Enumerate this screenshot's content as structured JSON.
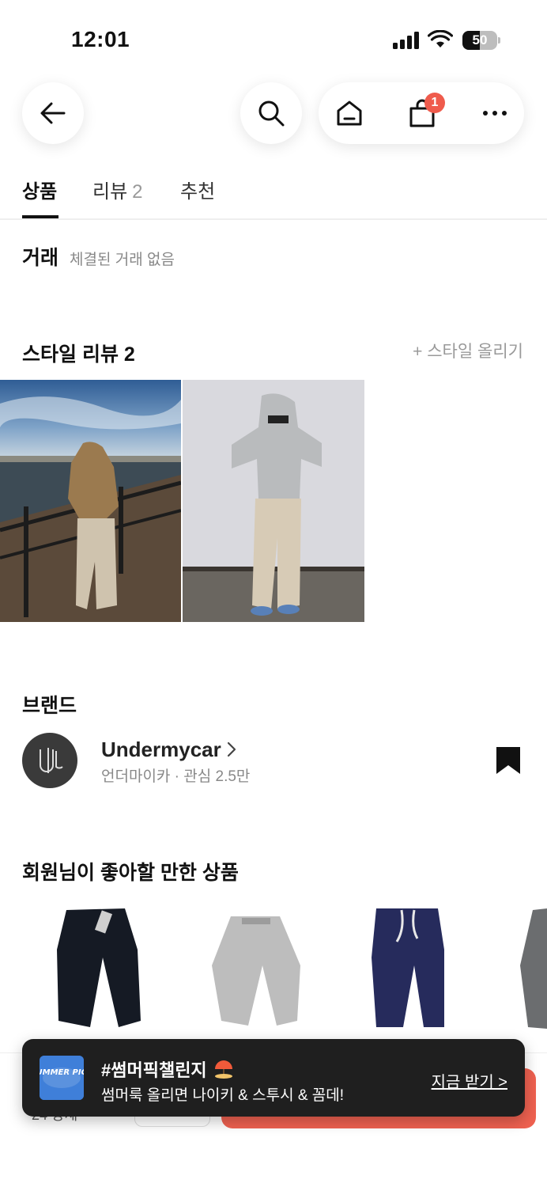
{
  "status_bar": {
    "time": "12:01",
    "battery_level": "50",
    "battery_fraction": 0.5
  },
  "header": {
    "cart_badge": "1"
  },
  "tabs": [
    {
      "label": "상품",
      "active": true
    },
    {
      "label": "리뷰",
      "count": "2"
    },
    {
      "label": "추천"
    }
  ],
  "trade": {
    "title": "거래",
    "status": "체결된 거래 없음"
  },
  "style_review": {
    "title": "스타일 리뷰 2",
    "upload_label": "+ 스타일 올리기"
  },
  "brand": {
    "section_title": "브랜드",
    "name": "Undermycar",
    "sub": "언더마이카 · 관심 2.5만"
  },
  "recommend": {
    "title": "회원님이 좋아할 만한 상품"
  },
  "bottom_bar": {
    "partial_text": "24    상세"
  },
  "toast": {
    "title": "#썸머픽챌린지",
    "subtitle": "썸머룩 올리면 나이키 & 스투시 & 꼼데!",
    "action": "지금 받기 >",
    "thumb_text": "SUMMER PICK"
  },
  "colors": {
    "accent": "#ef5b4c",
    "buy_button": "#ef6150",
    "toast_bg": "#1f1f1f",
    "brand_logo_bg": "#3a3a3a"
  }
}
